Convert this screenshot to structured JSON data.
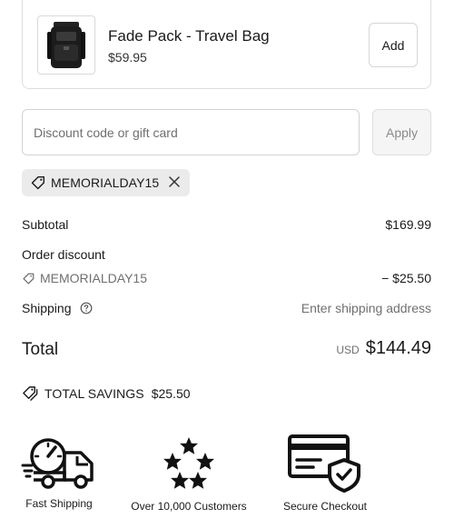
{
  "upsell": {
    "product_name": "Fade Pack - Travel Bag",
    "price": "$59.95",
    "add_label": "Add"
  },
  "discount": {
    "placeholder": "Discount code or gift card",
    "apply_label": "Apply",
    "applied_code": "MEMORIALDAY15"
  },
  "summary": {
    "subtotal_label": "Subtotal",
    "subtotal_value": "$169.99",
    "order_discount_label": "Order discount",
    "discount_code": "MEMORIALDAY15",
    "discount_value": "− $25.50",
    "shipping_label": "Shipping",
    "shipping_value": "Enter shipping address",
    "total_label": "Total",
    "total_currency": "USD",
    "total_value": "$144.49"
  },
  "savings": {
    "label": "TOTAL SAVINGS",
    "amount": "$25.50"
  },
  "badges": [
    {
      "caption": "Fast Shipping",
      "icon": "delivery-truck-icon"
    },
    {
      "caption": "Over 10,000 Customers",
      "icon": "five-stars-icon"
    },
    {
      "caption": "Secure Checkout",
      "icon": "secure-card-shield-icon"
    }
  ]
}
